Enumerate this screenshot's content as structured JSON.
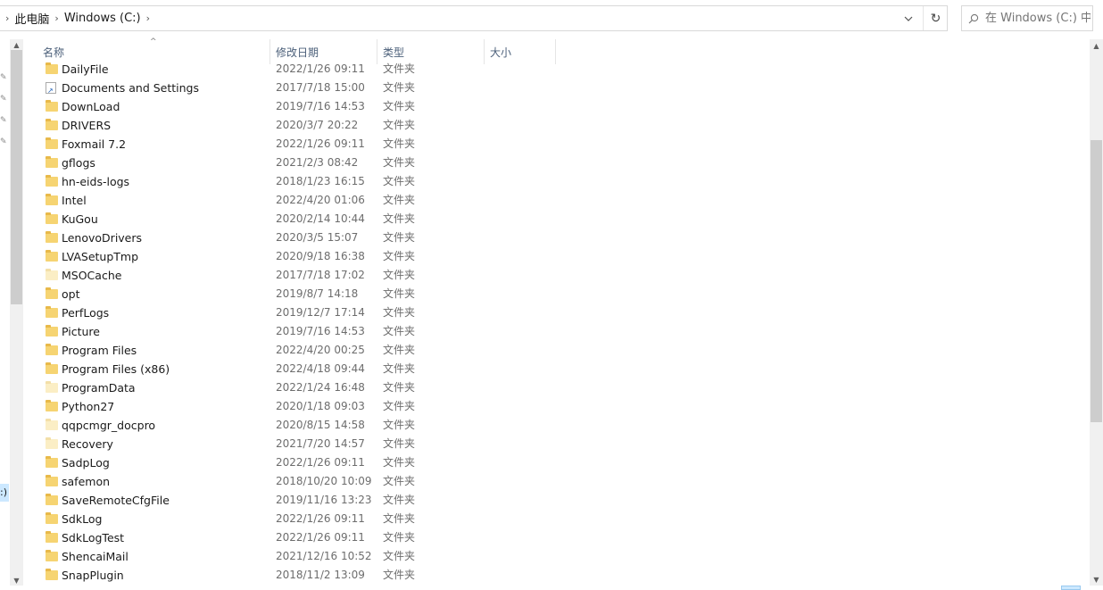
{
  "address_bar": {
    "crumbs": [
      "此电脑",
      "Windows (C:)"
    ],
    "separator": "›"
  },
  "search": {
    "placeholder": "在 Windows (C:) 中搜索"
  },
  "columns": {
    "name": "名称",
    "modified": "修改日期",
    "type": "类型",
    "size": "大小"
  },
  "nav": {
    "selected_label": ":)"
  },
  "icons": {
    "folder": "folder-icon",
    "shortcut": "shortcut-folder-icon",
    "refresh": "refresh-icon",
    "search": "search-icon",
    "dropdown": "chevron-down-icon",
    "pin": "pin-icon"
  },
  "files": [
    {
      "name": "DailyFile",
      "modified": "2022/1/26 09:11",
      "type": "文件夹",
      "icon": "folder"
    },
    {
      "name": "Documents and Settings",
      "modified": "2017/7/18 15:00",
      "type": "文件夹",
      "icon": "shortcut"
    },
    {
      "name": "DownLoad",
      "modified": "2019/7/16 14:53",
      "type": "文件夹",
      "icon": "folder"
    },
    {
      "name": "DRIVERS",
      "modified": "2020/3/7 20:22",
      "type": "文件夹",
      "icon": "folder"
    },
    {
      "name": "Foxmail 7.2",
      "modified": "2022/1/26 09:11",
      "type": "文件夹",
      "icon": "folder"
    },
    {
      "name": "gflogs",
      "modified": "2021/2/3 08:42",
      "type": "文件夹",
      "icon": "folder"
    },
    {
      "name": "hn-eids-logs",
      "modified": "2018/1/23 16:15",
      "type": "文件夹",
      "icon": "folder"
    },
    {
      "name": "Intel",
      "modified": "2022/4/20 01:06",
      "type": "文件夹",
      "icon": "folder"
    },
    {
      "name": "KuGou",
      "modified": "2020/2/14 10:44",
      "type": "文件夹",
      "icon": "folder"
    },
    {
      "name": "LenovoDrivers",
      "modified": "2020/3/5 15:07",
      "type": "文件夹",
      "icon": "folder"
    },
    {
      "name": "LVASetupTmp",
      "modified": "2020/9/18 16:38",
      "type": "文件夹",
      "icon": "folder"
    },
    {
      "name": "MSOCache",
      "modified": "2017/7/18 17:02",
      "type": "文件夹",
      "icon": "folder-hidden"
    },
    {
      "name": "opt",
      "modified": "2019/8/7 14:18",
      "type": "文件夹",
      "icon": "folder"
    },
    {
      "name": "PerfLogs",
      "modified": "2019/12/7 17:14",
      "type": "文件夹",
      "icon": "folder"
    },
    {
      "name": "Picture",
      "modified": "2019/7/16 14:53",
      "type": "文件夹",
      "icon": "folder"
    },
    {
      "name": "Program Files",
      "modified": "2022/4/20 00:25",
      "type": "文件夹",
      "icon": "folder"
    },
    {
      "name": "Program Files (x86)",
      "modified": "2022/4/18 09:44",
      "type": "文件夹",
      "icon": "folder"
    },
    {
      "name": "ProgramData",
      "modified": "2022/1/24 16:48",
      "type": "文件夹",
      "icon": "folder-hidden"
    },
    {
      "name": "Python27",
      "modified": "2020/1/18 09:03",
      "type": "文件夹",
      "icon": "folder"
    },
    {
      "name": "qqpcmgr_docpro",
      "modified": "2020/8/15 14:58",
      "type": "文件夹",
      "icon": "folder-hidden"
    },
    {
      "name": "Recovery",
      "modified": "2021/7/20 14:57",
      "type": "文件夹",
      "icon": "folder-hidden"
    },
    {
      "name": "SadpLog",
      "modified": "2022/1/26 09:11",
      "type": "文件夹",
      "icon": "folder"
    },
    {
      "name": "safemon",
      "modified": "2018/10/20 10:09",
      "type": "文件夹",
      "icon": "folder"
    },
    {
      "name": "SaveRemoteCfgFile",
      "modified": "2019/11/16 13:23",
      "type": "文件夹",
      "icon": "folder"
    },
    {
      "name": "SdkLog",
      "modified": "2022/1/26 09:11",
      "type": "文件夹",
      "icon": "folder"
    },
    {
      "name": "SdkLogTest",
      "modified": "2022/1/26 09:11",
      "type": "文件夹",
      "icon": "folder"
    },
    {
      "name": "ShencaiMail",
      "modified": "2021/12/16 10:52",
      "type": "文件夹",
      "icon": "folder"
    },
    {
      "name": "SnapPlugin",
      "modified": "2018/11/2 13:09",
      "type": "文件夹",
      "icon": "folder"
    }
  ]
}
